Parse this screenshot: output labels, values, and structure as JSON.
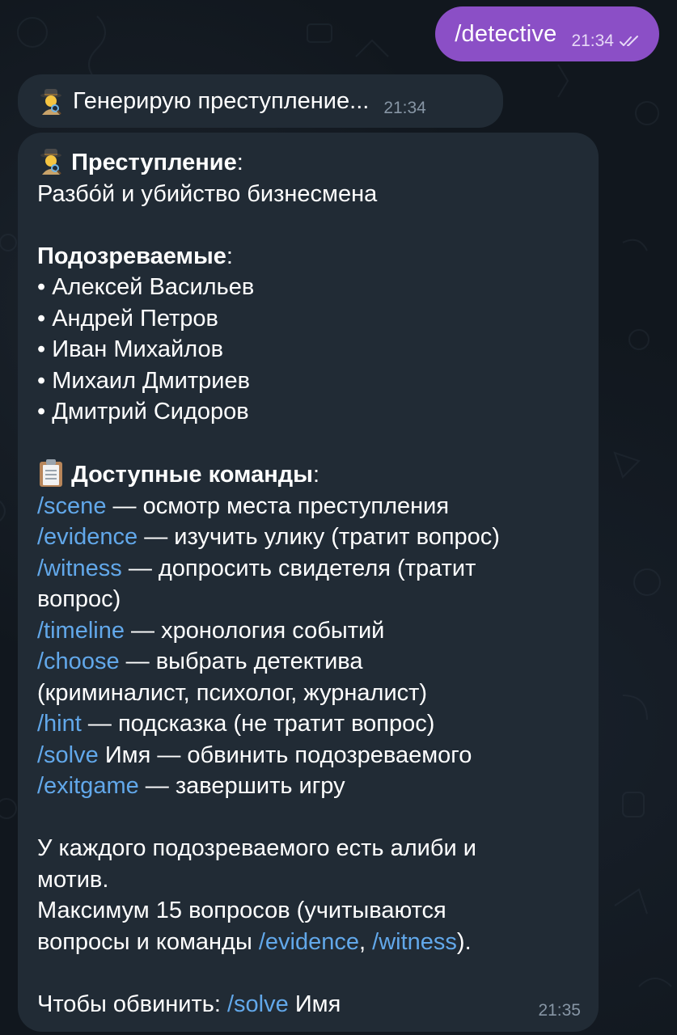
{
  "outgoing": {
    "text": "/detective",
    "time": "21:34",
    "status_icon": "double-check-icon"
  },
  "generating": {
    "emoji": "detective-emoji",
    "text": "Генерирую преступление...",
    "time": "21:34"
  },
  "game": {
    "crime_label": "Преступление",
    "crime_colon": ":",
    "crime_text": "Разбо́й и убийство бизнесмена",
    "suspects_label": "Подозреваемые",
    "suspects_colon": ":",
    "bullet": "•",
    "suspects": [
      "Алексей Васильев",
      "Андрей Петров",
      "Иван Михайлов",
      "Михаил Дмитриев",
      "Дмитрий Сидоров"
    ],
    "commands_label": "Доступные команды",
    "commands_colon": ":",
    "commands": [
      {
        "cmd": "/scene",
        "desc": " — осмотр места преступления"
      },
      {
        "cmd": "/evidence",
        "desc": " — изучить улику (тратит вопрос)"
      },
      {
        "cmd": "/witness",
        "desc": " — допросить свидетеля (тратит"
      },
      {
        "cmd": "",
        "desc": "вопрос)"
      },
      {
        "cmd": "/timeline",
        "desc": " — хронология событий"
      },
      {
        "cmd": "/choose",
        "desc": " — выбрать детектива"
      },
      {
        "cmd": "",
        "desc": "(криминалист, психолог, журналист)"
      },
      {
        "cmd": "/hint",
        "desc": " — подсказка (не тратит вопрос)"
      },
      {
        "cmd": "/solve",
        "desc": " Имя — обвинить подозреваемого"
      },
      {
        "cmd": "/exitgame",
        "desc": " — завершить игру"
      }
    ],
    "info_line1": "У каждого подозреваемого есть алиби и",
    "info_line2": "мотив.",
    "max_line1": "Максимум 15 вопросов (учитываются",
    "max_line2_prefix": "вопросы и команды ",
    "max_cmd1": "/evidence",
    "max_sep": ", ",
    "max_cmd2": "/witness",
    "max_suffix": ").",
    "accuse_prefix": "Чтобы обвинить: ",
    "accuse_cmd": "/solve",
    "accuse_suffix": " Имя",
    "time": "21:35"
  },
  "colors": {
    "outgoing_bubble": "#8b4fc6",
    "incoming_bubble": "#212b35",
    "link": "#62a8ea",
    "time_in": "#8796a5"
  }
}
